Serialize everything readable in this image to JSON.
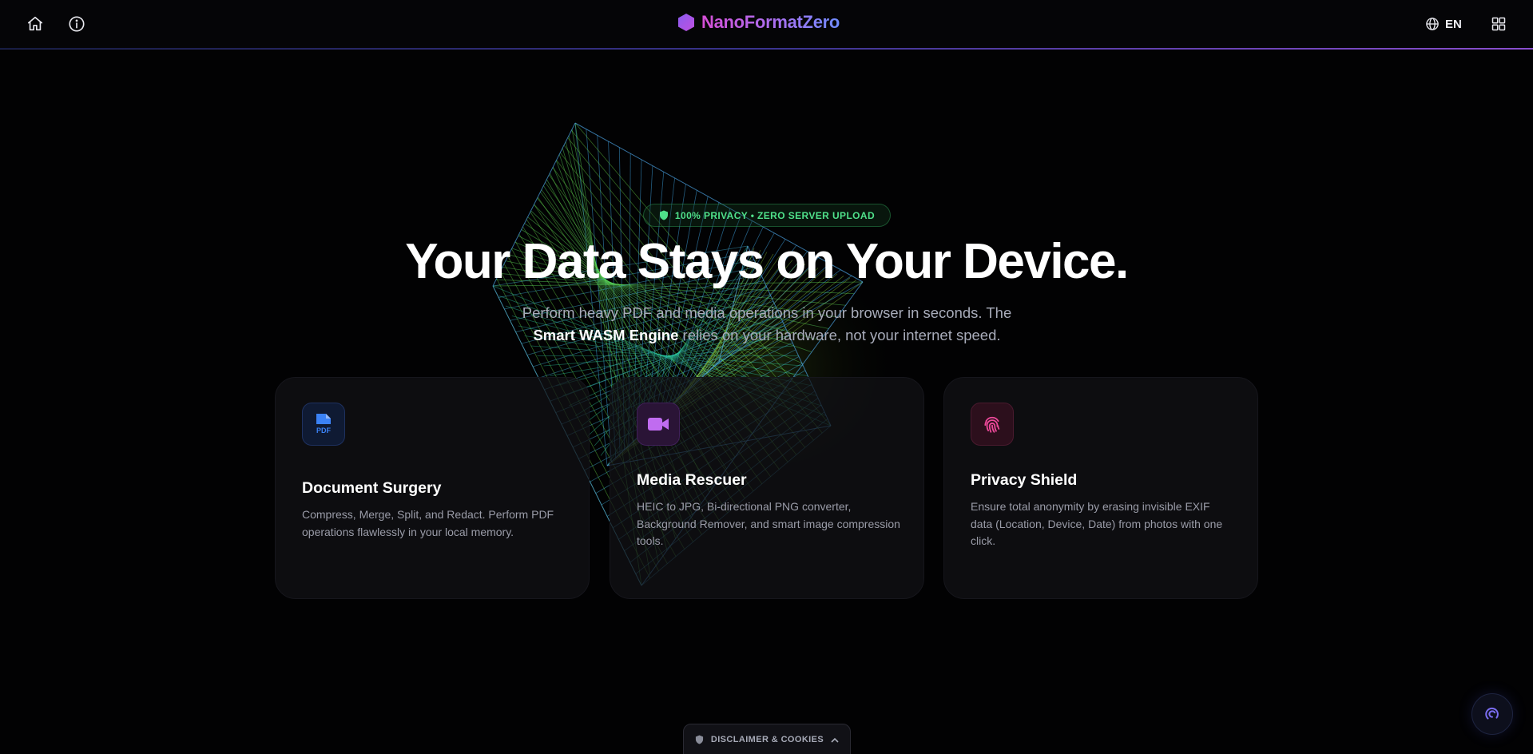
{
  "header": {
    "brand_name": "NanoFormatZero",
    "language_label": "EN",
    "icons": {
      "home": "home-icon",
      "info": "info-icon",
      "globe": "globe-icon",
      "apps": "grid-icon",
      "logo": "hexagon-icon"
    }
  },
  "hero": {
    "badge_text": "100% PRIVACY • ZERO SERVER UPLOAD",
    "title": "Your Data Stays on Your Device.",
    "subtitle_part1": "Perform heavy PDF and media operations in your browser in seconds. The",
    "subtitle_strong": "Smart WASM Engine",
    "subtitle_part2": "relies on your hardware, not your internet speed."
  },
  "features": [
    {
      "title": "Document Surgery",
      "description": "Compress, Merge, Split, and Redact. Perform PDF operations flawlessly in your local memory.",
      "icon": "pdf-icon",
      "icon_label": "PDF"
    },
    {
      "title": "Media Rescuer",
      "description": "HEIC to JPG, Bi-directional PNG converter, Background Remover, and smart image compression tools.",
      "icon": "video-camera-icon"
    },
    {
      "title": "Privacy Shield",
      "description": "Ensure total anonymity by erasing invisible EXIF data (Location, Device, Date) from photos with one click.",
      "icon": "fingerprint-icon"
    }
  ],
  "footer": {
    "disclaimer_label": "DISCLAIMER & COOKIES"
  },
  "colors": {
    "background": "#020203",
    "badge_green": "#4fe08a",
    "pdf_blue": "#3b82f6",
    "media_purple": "#c06cf0",
    "privacy_pink": "#ec4899",
    "brand_start": "#d64fd6",
    "brand_end": "#6f8cff"
  }
}
